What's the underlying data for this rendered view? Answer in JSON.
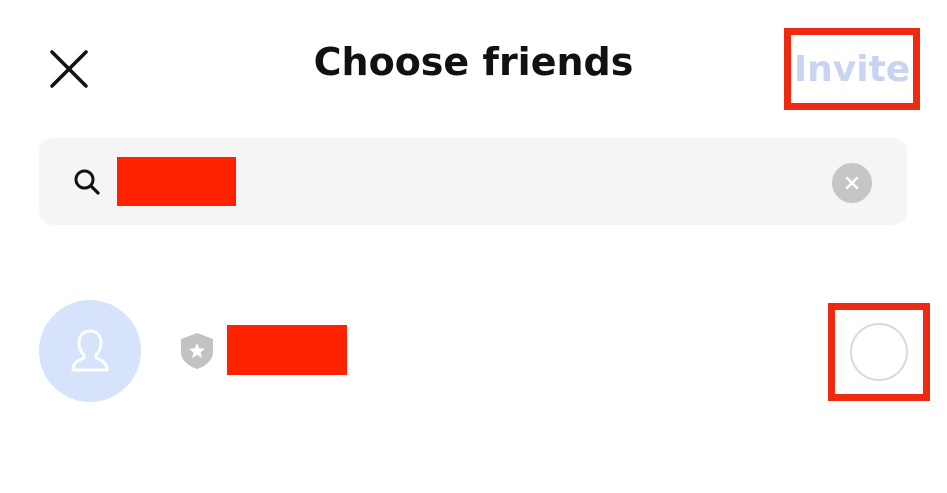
{
  "header": {
    "title": "Choose friends",
    "invite_label": "Invite"
  },
  "search": {
    "value": "",
    "placeholder": ""
  },
  "friends": [
    {
      "name": "",
      "selected": false
    }
  ],
  "colors": {
    "invite_disabled": "#c9d3f2",
    "highlight_box": "#ee2a10",
    "redaction": "#ff2200",
    "avatar_bg": "#d6e3fb",
    "search_bg": "#f5f5f5"
  },
  "icons": {
    "close": "close-icon",
    "search": "search-icon",
    "clear": "clear-icon",
    "avatar": "person-icon",
    "badge": "star-shield-icon"
  }
}
